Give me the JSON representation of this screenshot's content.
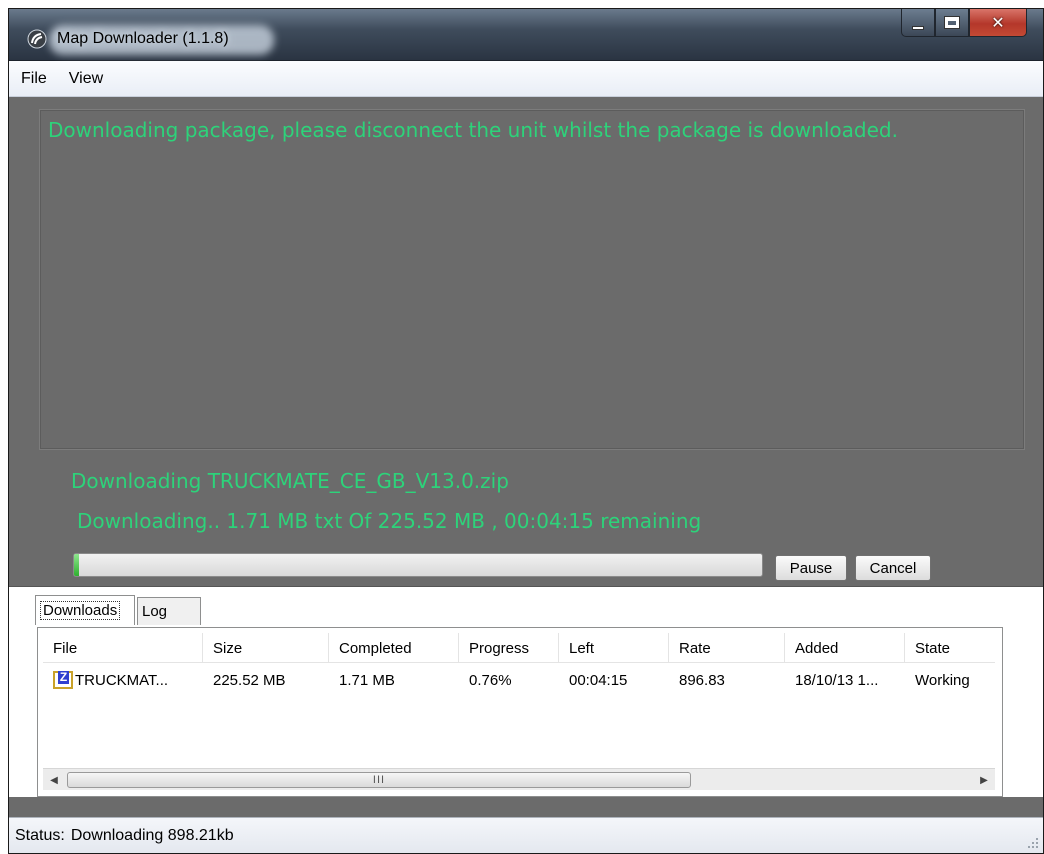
{
  "window": {
    "title": "Map Downloader (1.1.8)",
    "icons": {
      "app": "app-logo-icon",
      "minimize": "minimize-icon",
      "maximize": "maximize-icon",
      "close": "close-icon"
    }
  },
  "menu": {
    "items": [
      "File",
      "View"
    ]
  },
  "message": "Downloading package, please disconnect the unit whilst the package is downloaded.",
  "download": {
    "line1": "Downloading TRUCKMATE_CE_GB_V13.0.zip",
    "line2": "Downloading.. 1.71 MB txt Of 225.52 MB , 00:04:15 remaining",
    "progress_fraction": 0.0076,
    "pause_label": "Pause",
    "cancel_label": "Cancel"
  },
  "tabs": [
    {
      "label": "Downloads",
      "selected": true
    },
    {
      "label": "Log",
      "selected": false
    }
  ],
  "list": {
    "columns": [
      "File",
      "Size",
      "Completed",
      "Progress",
      "Left",
      "Rate",
      "Added",
      "State"
    ],
    "rows": [
      {
        "file": "TRUCKMAT...",
        "size": "225.52 MB",
        "completed": "1.71 MB",
        "progress": "0.76%",
        "left": "00:04:15",
        "rate": "896.83",
        "added": "18/10/13 1...",
        "state": "Working",
        "icon": "zip-file-icon"
      }
    ],
    "scroll_thumb_label": "III"
  },
  "status": {
    "label": "Status:",
    "value": "Downloading 898.21kb"
  },
  "colors": {
    "message_text": "#2dd37a",
    "panel_background": "#6b6b6b",
    "progress_fill": "#2fb02f"
  }
}
